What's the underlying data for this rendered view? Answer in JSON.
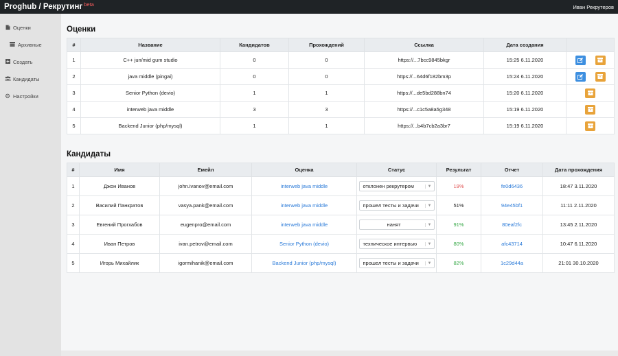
{
  "app": {
    "title": "Proghub / Рекрутинг",
    "badge": "beta",
    "user": "Иван Рекрутеров"
  },
  "sidebar": {
    "items": [
      {
        "label": "Оценки",
        "icon": "document-icon"
      },
      {
        "label": "Архивные",
        "icon": "archive-icon"
      },
      {
        "label": "Создать",
        "icon": "plus-box-icon"
      },
      {
        "label": "Кандидаты",
        "icon": "users-icon"
      },
      {
        "label": "Настройки",
        "icon": "gear-icon"
      }
    ]
  },
  "assessments": {
    "title": "Оценки",
    "columns": [
      "#",
      "Название",
      "Кандидатов",
      "Прохождений",
      "Ссылка",
      "Дата создания",
      ""
    ],
    "rows": [
      {
        "n": "1",
        "name": "C++ jun/mid gum studio",
        "candidates": "0",
        "passes": "0",
        "link": "https://...7bcc9845bkgr",
        "date": "15:25 6.11.2020",
        "editable": true
      },
      {
        "n": "2",
        "name": "java middle (pingai)",
        "candidates": "0",
        "passes": "0",
        "link": "https://...64d6f182bm3p",
        "date": "15:24 6.11.2020",
        "editable": true
      },
      {
        "n": "3",
        "name": "Senior Python (devio)",
        "candidates": "1",
        "passes": "1",
        "link": "https://...de5bd288bn74",
        "date": "15:20 6.11.2020",
        "editable": false
      },
      {
        "n": "4",
        "name": "interweb java middle",
        "candidates": "3",
        "passes": "3",
        "link": "https://...c1c5a8a5g348",
        "date": "15:19 6.11.2020",
        "editable": false
      },
      {
        "n": "5",
        "name": "Backend Junior (php/mysql)",
        "candidates": "1",
        "passes": "1",
        "link": "https://...b4b7cb2a3br7",
        "date": "15:19 6.11.2020",
        "editable": false
      }
    ]
  },
  "candidates": {
    "title": "Кандидаты",
    "columns": [
      "#",
      "Имя",
      "Емейл",
      "Оценка",
      "Статус",
      "Результат",
      "Отчет",
      "Дата прохождения"
    ],
    "rows": [
      {
        "n": "1",
        "name": "Джон Иванов",
        "email": "john.ivanov@email.com",
        "assessment": "interweb java middle",
        "status": "отклонен рекрутером",
        "result": "19%",
        "result_color": "#e05050",
        "report": "fe0d6436",
        "date": "18:47 3.11.2020"
      },
      {
        "n": "2",
        "name": "Василий Панкратов",
        "email": "vasya.pank@email.com",
        "assessment": "interweb java middle",
        "status": "прошел тесты и задачи",
        "result": "51%",
        "result_color": "#222222",
        "report": "94e45bf1",
        "date": "11:11 2.11.2020"
      },
      {
        "n": "3",
        "name": "Евгений Прогхабов",
        "email": "eugenpro@email.com",
        "assessment": "interweb java middle",
        "status": "нанят",
        "result": "91%",
        "result_color": "#37a847",
        "report": "80eaf2fc",
        "date": "13:45 2.11.2020"
      },
      {
        "n": "4",
        "name": "Иван Петров",
        "email": "ivan.petrov@email.com",
        "assessment": "Senior Python (devio)",
        "status": "техническое интервью",
        "result": "80%",
        "result_color": "#37a847",
        "report": "afc43714",
        "date": "10:47 6.11.2020"
      },
      {
        "n": "5",
        "name": "Игорь Михайлик",
        "email": "igormihanik@email.com",
        "assessment": "Backend Junior (php/mysql)",
        "status": "прошел тесты и задачи",
        "result": "82%",
        "result_color": "#37a847",
        "report": "1c29d44a",
        "date": "21:01 30.10.2020"
      }
    ]
  }
}
